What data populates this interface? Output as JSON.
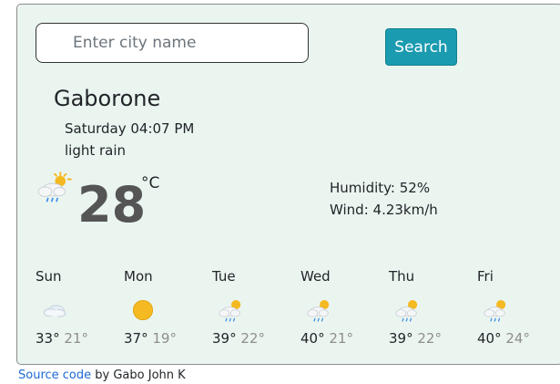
{
  "search": {
    "placeholder": "Enter city name",
    "button_label": "Search"
  },
  "current": {
    "city": "Gaborone",
    "datetime": "Saturday 04:07 PM",
    "condition": "light rain",
    "icon": "sun-cloud-rain-icon",
    "temperature": "28",
    "unit": "°C",
    "humidity": "Humidity: 52%",
    "wind": "Wind: 4.23km/h"
  },
  "forecast": [
    {
      "day": "Sun",
      "icon": "cloudy-icon",
      "max": "33°",
      "min": "21°"
    },
    {
      "day": "Mon",
      "icon": "sun-icon",
      "max": "37°",
      "min": "19°"
    },
    {
      "day": "Tue",
      "icon": "sun-cloud-rain-icon",
      "max": "39°",
      "min": "22°"
    },
    {
      "day": "Wed",
      "icon": "sun-cloud-rain-icon",
      "max": "40°",
      "min": "21°"
    },
    {
      "day": "Thu",
      "icon": "sun-cloud-rain-icon",
      "max": "39°",
      "min": "22°"
    },
    {
      "day": "Fri",
      "icon": "sun-cloud-rain-icon",
      "max": "40°",
      "min": "24°"
    }
  ],
  "footer": {
    "link_text": "Source code",
    "by_text": " by Gabo John K"
  },
  "colors": {
    "card_background": "#ebf5f0",
    "search_button": "#1a9bb0",
    "temperature_text": "#555555",
    "min_temp_text": "#8e8e8e",
    "link": "#1d6ad6",
    "sun": "#f5b921"
  }
}
